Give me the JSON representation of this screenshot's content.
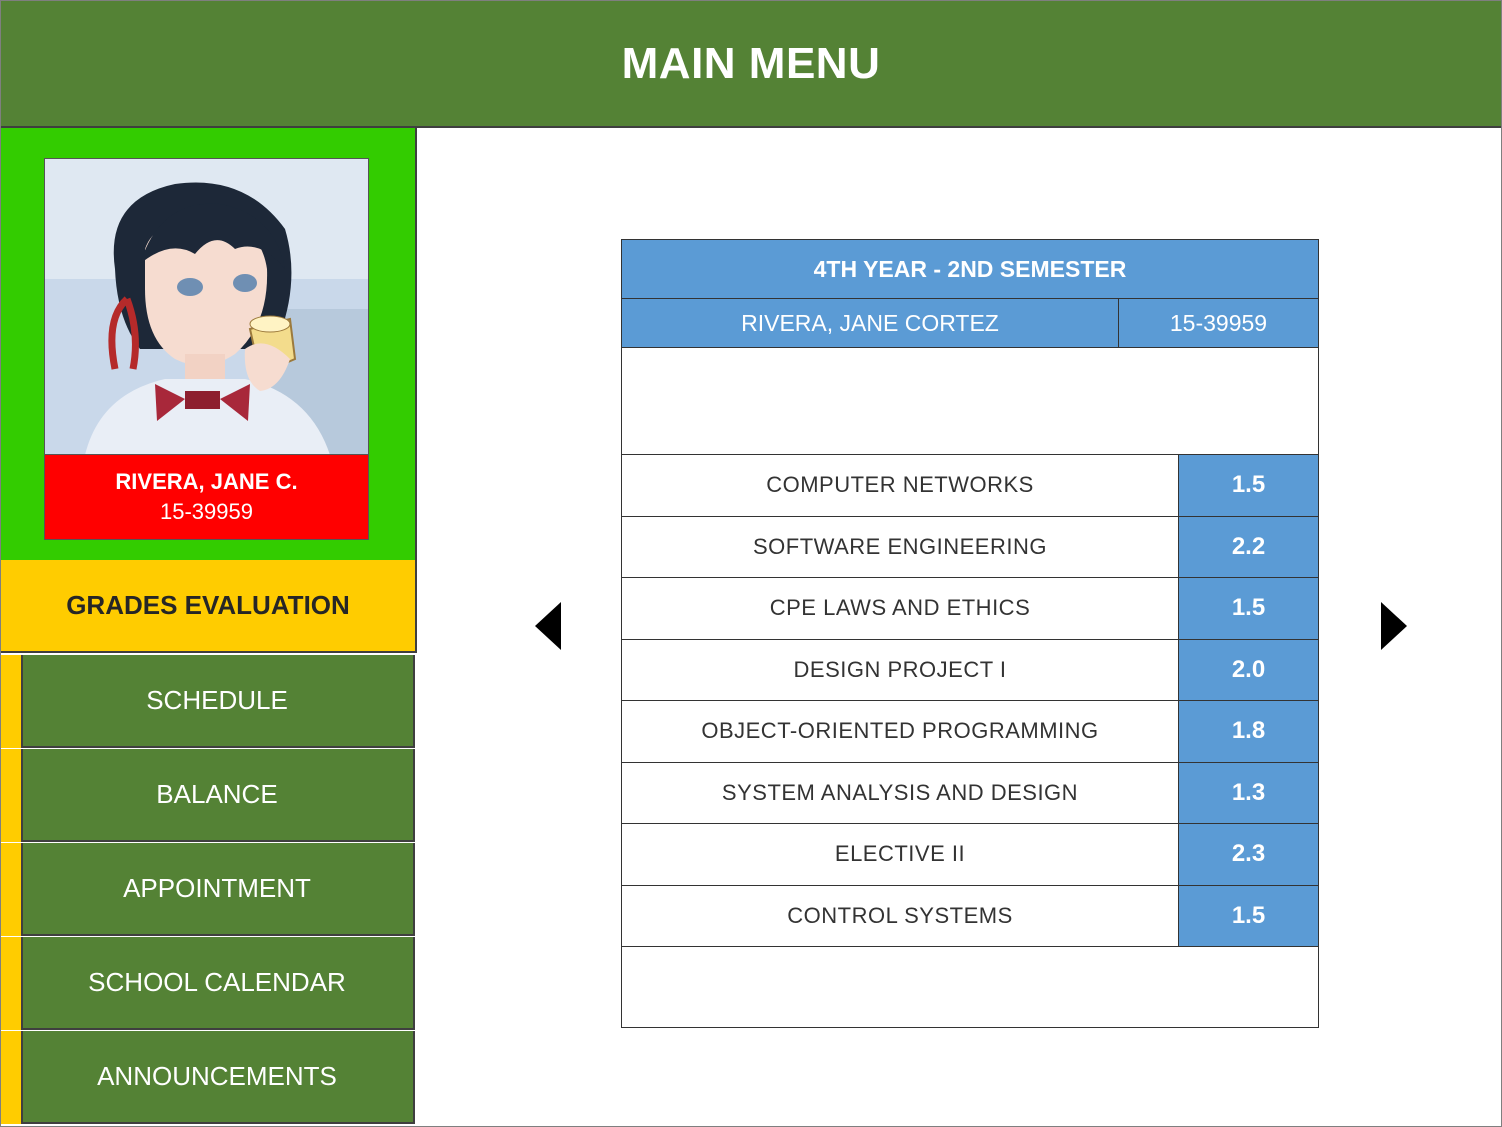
{
  "header": {
    "title": "MAIN MENU"
  },
  "profile": {
    "short_name": "RIVERA, JANE C.",
    "student_id": "15-39959"
  },
  "menu": {
    "active": "GRADES EVALUATION",
    "items": [
      {
        "label": "SCHEDULE"
      },
      {
        "label": "BALANCE"
      },
      {
        "label": "APPOINTMENT"
      },
      {
        "label": "SCHOOL CALENDAR"
      },
      {
        "label": "ANNOUNCEMENTS"
      }
    ]
  },
  "grades": {
    "term": "4TH YEAR - 2ND SEMESTER",
    "full_name": "RIVERA, JANE CORTEZ",
    "student_id": "15-39959",
    "rows": [
      {
        "subject": "COMPUTER NETWORKS",
        "grade": "1.5"
      },
      {
        "subject": "SOFTWARE ENGINEERING",
        "grade": "2.2"
      },
      {
        "subject": "CPE LAWS AND ETHICS",
        "grade": "1.5"
      },
      {
        "subject": "DESIGN PROJECT I",
        "grade": "2.0"
      },
      {
        "subject": "OBJECT-ORIENTED PROGRAMMING",
        "grade": "1.8"
      },
      {
        "subject": "SYSTEM ANALYSIS AND DESIGN",
        "grade": "1.3"
      },
      {
        "subject": "ELECTIVE II",
        "grade": "2.3"
      },
      {
        "subject": "CONTROL SYSTEMS",
        "grade": "1.5"
      }
    ]
  },
  "icons": {
    "prev": "caret-left-icon",
    "next": "caret-right-icon"
  },
  "colors": {
    "header_green": "#548235",
    "profile_green": "#33cc00",
    "active_yellow": "#ffcc00",
    "name_red": "#ff0000",
    "table_blue": "#5b9bd5"
  }
}
